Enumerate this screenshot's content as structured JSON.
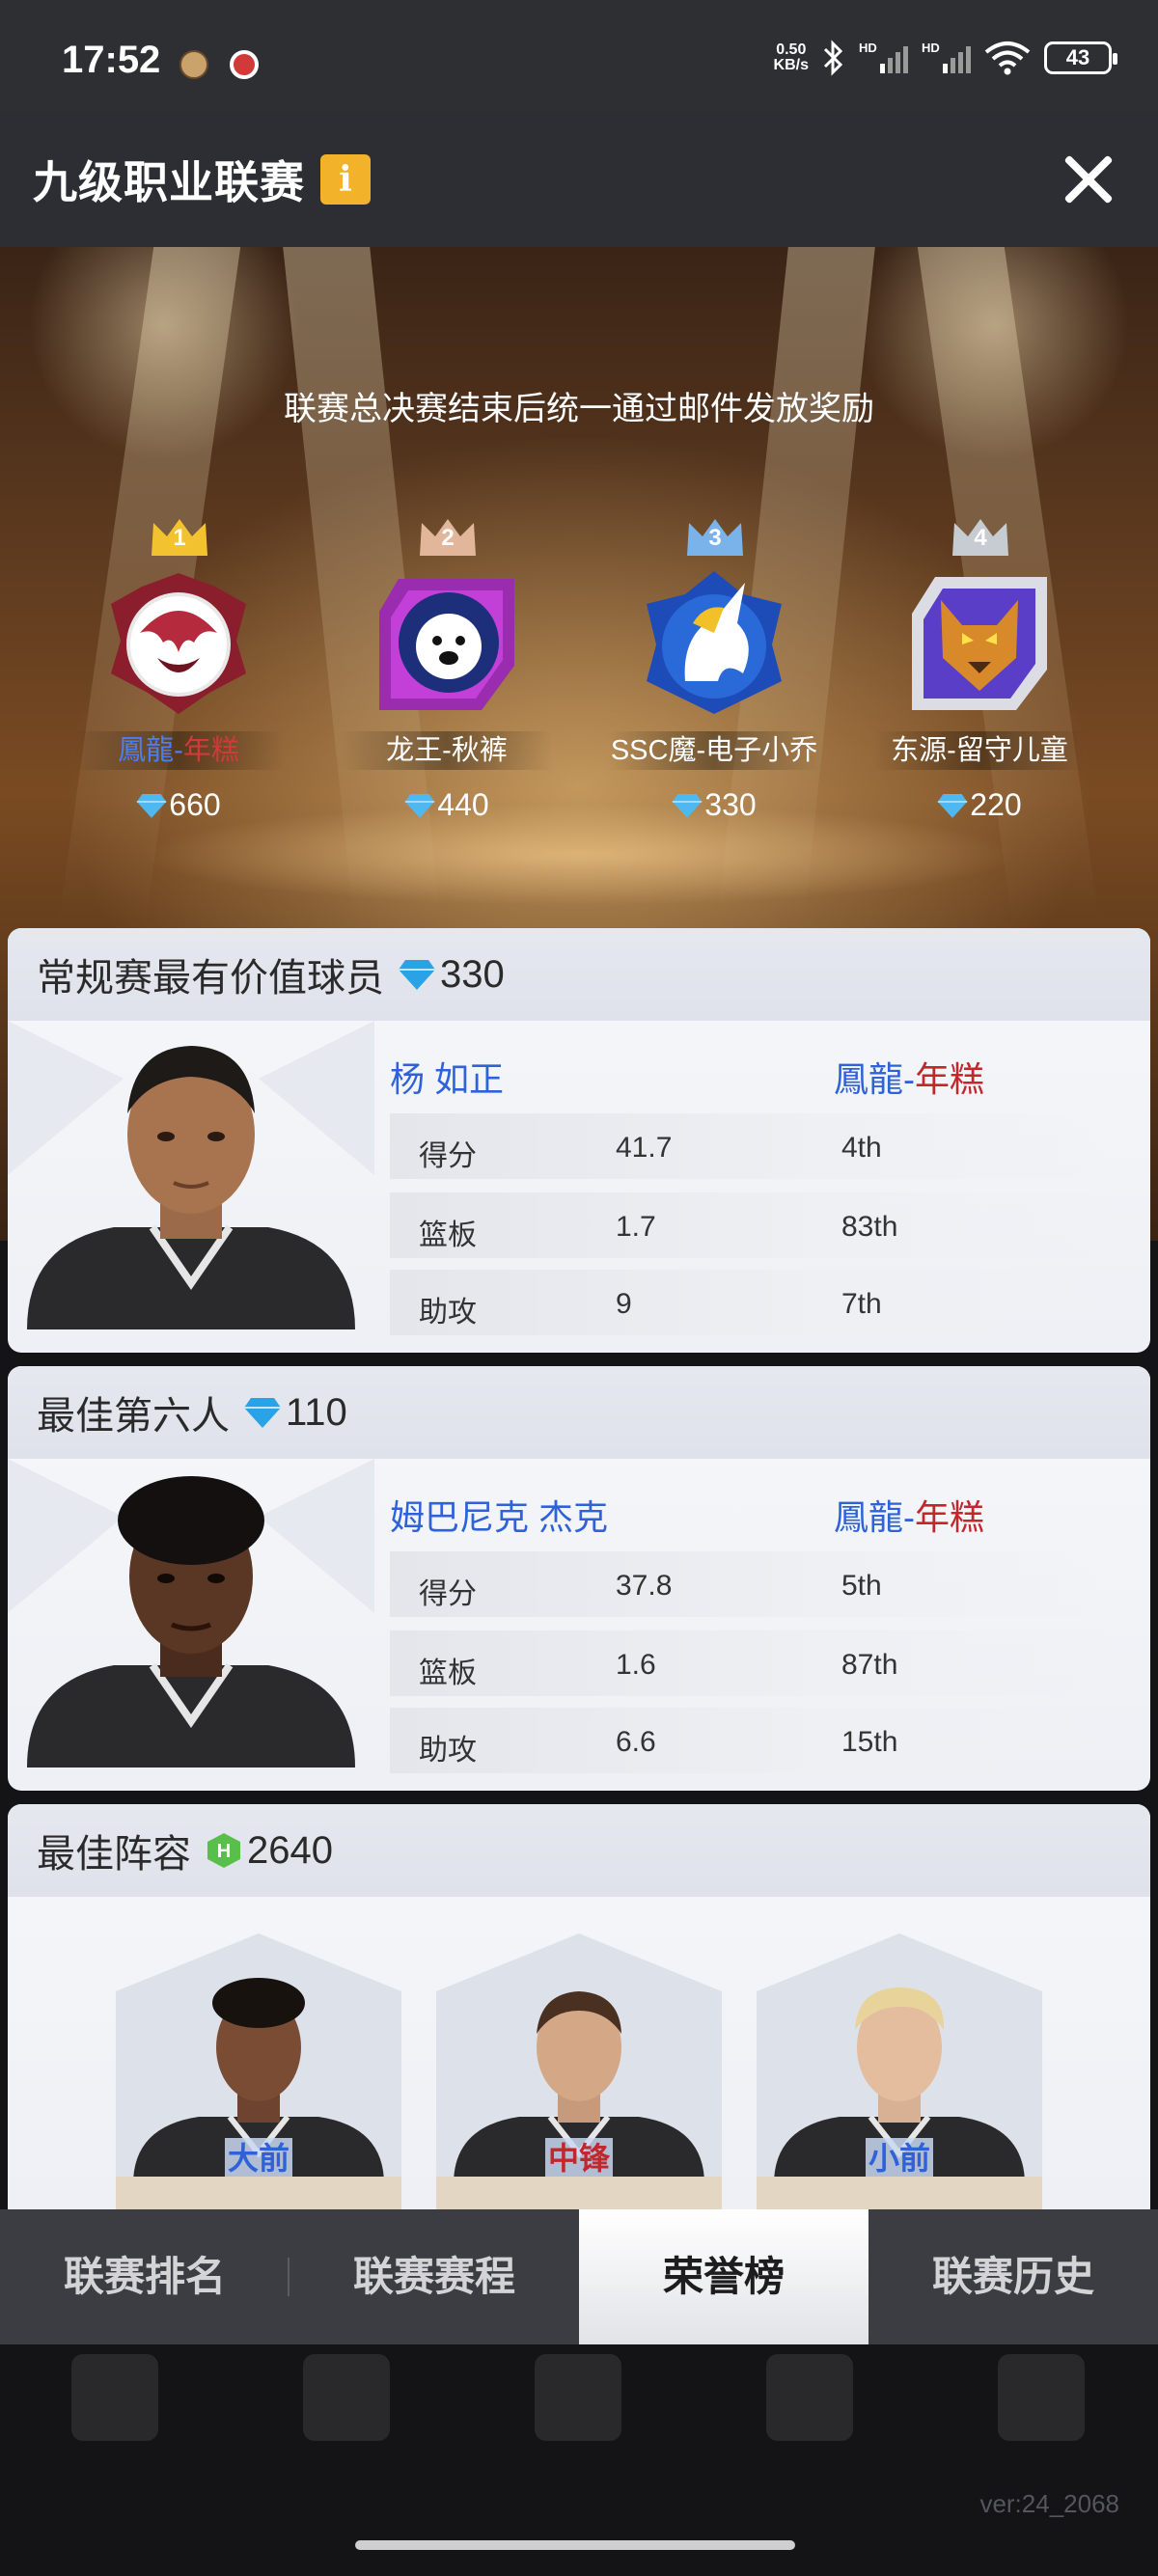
{
  "status_bar": {
    "time": "17:52",
    "net_speed_value": "0.50",
    "net_speed_unit": "KB/s",
    "signal_1_label": "HD",
    "signal_2_label": "HD",
    "battery": "43",
    "icons": [
      "app-avatar-icon",
      "notification-icon",
      "bluetooth-icon",
      "signal-icon",
      "wifi-icon",
      "battery-icon"
    ]
  },
  "header": {
    "title": "九级职业联赛",
    "info_label": "i"
  },
  "hero": {
    "notice": "联赛总决赛结束后统一通过邮件发放奖励",
    "teams": [
      {
        "rank": "1",
        "name_blue": "鳳龍-",
        "name_red": "年糕",
        "name": "",
        "reward": "660"
      },
      {
        "rank": "2",
        "name": "龙王-秋裤",
        "reward": "440"
      },
      {
        "rank": "3",
        "name": "SSC魔-电子小乔",
        "reward": "330"
      },
      {
        "rank": "4",
        "name": "东源-留守儿童",
        "reward": "220"
      }
    ]
  },
  "mvp": {
    "title": "常规赛最有价值球员",
    "reward": "330",
    "player_name": "杨 如正",
    "team_blue": "鳳龍-",
    "team_red": "年糕",
    "stats": [
      {
        "label": "得分",
        "value": "41.7",
        "rank": "4th"
      },
      {
        "label": "篮板",
        "value": "1.7",
        "rank": "83th"
      },
      {
        "label": "助攻",
        "value": "9",
        "rank": "7th"
      }
    ]
  },
  "sixth_man": {
    "title": "最佳第六人",
    "reward": "110",
    "player_name": "姆巴尼克 杰克",
    "team_blue": "鳳龍-",
    "team_red": "年糕",
    "stats": [
      {
        "label": "得分",
        "value": "37.8",
        "rank": "5th"
      },
      {
        "label": "篮板",
        "value": "1.6",
        "rank": "87th"
      },
      {
        "label": "助攻",
        "value": "6.6",
        "rank": "15th"
      }
    ]
  },
  "best_lineup": {
    "title": "最佳阵容",
    "reward": "2640",
    "positions": [
      "大前",
      "中锋",
      "小前"
    ]
  },
  "tabs": [
    {
      "label": "联赛排名",
      "active": false
    },
    {
      "label": "联赛赛程",
      "active": false
    },
    {
      "label": "荣誉榜",
      "active": true
    },
    {
      "label": "联赛历史",
      "active": false
    }
  ],
  "version": "ver:24_2068",
  "colors": {
    "accent_gold": "#f2b22a",
    "name_blue": "#2f62d8",
    "name_red": "#c0282c",
    "header_bg": "#2c2e33",
    "tab_bg": "#3b3d42"
  }
}
